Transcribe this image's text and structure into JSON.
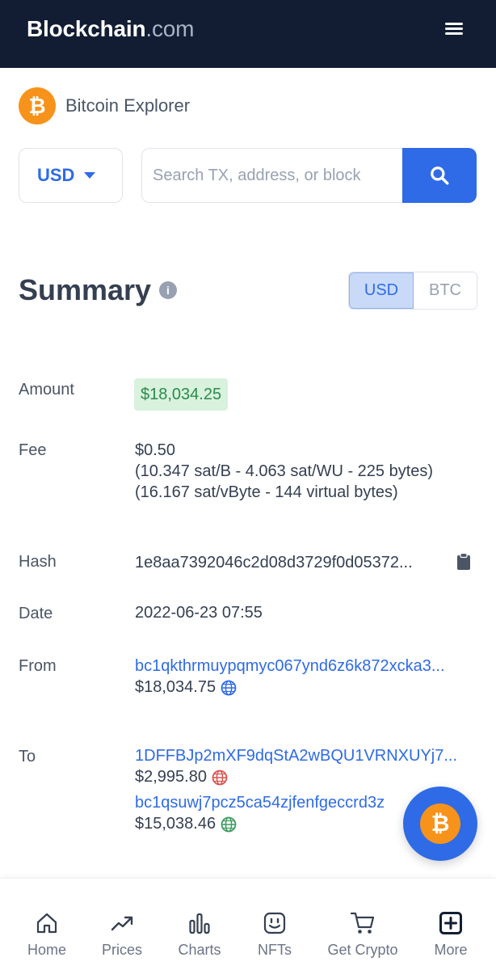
{
  "header": {
    "brand_main": "Blockchain",
    "brand_suffix": ".com",
    "menu_icon": "hamburger-menu-icon"
  },
  "explorer": {
    "logo_symbol": "₿",
    "title": "Bitcoin Explorer"
  },
  "currency_select": {
    "value": "USD"
  },
  "search": {
    "placeholder": "Search TX, address, or block",
    "icon": "search-icon"
  },
  "summary": {
    "title": "Summary",
    "info_symbol": "i",
    "toggle": {
      "active": "USD",
      "inactive": "BTC"
    },
    "amount": {
      "label": "Amount",
      "value": "$18,034.25"
    },
    "fee": {
      "label": "Fee",
      "line1": "$0.50",
      "line2": "(10.347 sat/B - 4.063 sat/WU - 225 bytes)",
      "line3": "(16.167 sat/vByte - 144 virtual bytes)"
    },
    "hash": {
      "label": "Hash",
      "value": "1e8aa7392046c2d08d3729f0d05372..."
    },
    "date": {
      "label": "Date",
      "value": "2022-06-23 07:55"
    },
    "from": {
      "label": "From",
      "address": "bc1qkthrmuypqmyc067ynd6z6k872xcka3...",
      "amount": "$18,034.75"
    },
    "to": {
      "label": "To",
      "outputs": [
        {
          "address": "1DFFBJp2mXF9dqStA2wBQU1VRNXUYj7...",
          "amount": "$2,995.80",
          "status_color": "#d9534f"
        },
        {
          "address": "bc1qsuwj7pcz5ca54zjfenfgeccrd3z",
          "amount": "$15,038.46",
          "status_color": "#3c9b5e"
        }
      ]
    }
  },
  "fab": {
    "symbol": "₿"
  },
  "bottom_nav": [
    {
      "label": "Home",
      "icon": "home-icon"
    },
    {
      "label": "Prices",
      "icon": "trending-up-icon"
    },
    {
      "label": "Charts",
      "icon": "bar-chart-icon"
    },
    {
      "label": "NFTs",
      "icon": "smiley-face-icon"
    },
    {
      "label": "Get Crypto",
      "icon": "shopping-cart-icon"
    },
    {
      "label": "More",
      "icon": "plus-square-icon"
    }
  ],
  "colors": {
    "nav_bg": "#121d33",
    "accent": "#2f6be6",
    "bitcoin": "#f7931a",
    "amount_bg": "#d8f2dd",
    "amount_text": "#2c8a4b"
  }
}
